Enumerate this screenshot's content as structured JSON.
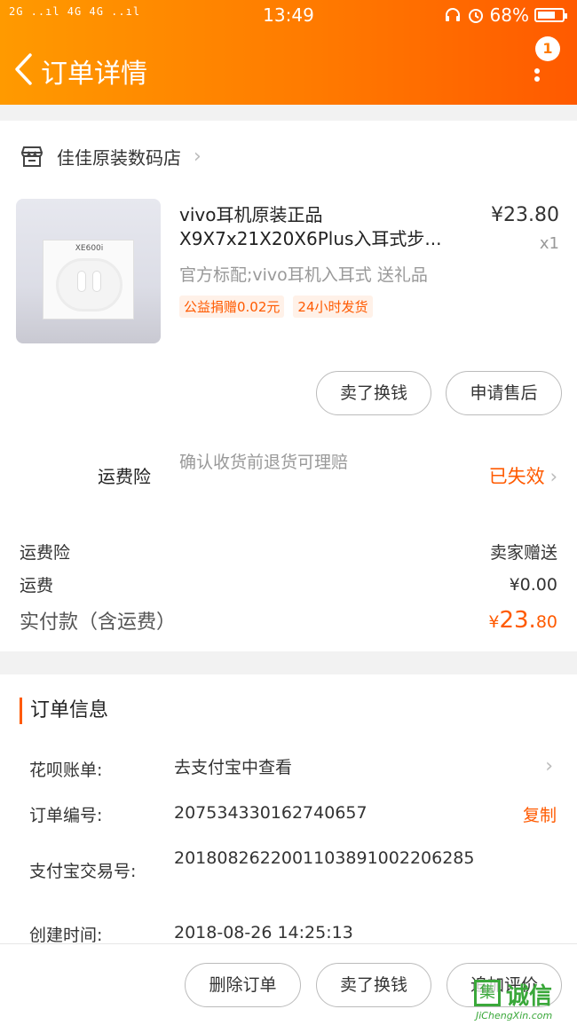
{
  "status_bar": {
    "signal": "2G ..ıl 4G 4G ..ıl",
    "time": "13:49",
    "icons": [
      "headset-icon",
      "alarm-icon"
    ],
    "battery": "68%"
  },
  "nav": {
    "back_icon": "‹",
    "title": "订单详情",
    "more_badge": "1"
  },
  "shop": {
    "name": "佳佳原装数码店",
    "chevron": "›"
  },
  "product": {
    "image_label": "XE600i",
    "title_line1": "vivo耳机原装正品",
    "title_line2": "X9X7x21X20X6Plus入耳式步...",
    "price": "¥23.80",
    "qty": "x1",
    "spec": "官方标配;vivo耳机入耳式 送礼品",
    "tags": [
      "公益捐赠0.02元",
      "24小时发货"
    ]
  },
  "item_actions": {
    "sell": "卖了换钱",
    "after_sale": "申请售后"
  },
  "insurance": {
    "title": "运费险",
    "desc": "确认收货前退货可理赔",
    "status": "已失效",
    "chevron": "›"
  },
  "summary": {
    "rows": [
      {
        "label": "运费险",
        "value": "卖家赠送"
      },
      {
        "label": "运费",
        "value": "¥0.00"
      }
    ],
    "total_label": "实付款（含运费）",
    "total_currency": "¥",
    "total_int": "23.",
    "total_dec": "80"
  },
  "order_info": {
    "title": "订单信息",
    "rows": [
      {
        "label": "花呗账单:",
        "value": "去支付宝中查看",
        "action": "›"
      },
      {
        "label": "订单编号:",
        "value": "207534330162740657",
        "action": "复制"
      },
      {
        "label": "支付宝交易号:",
        "value": "2018082622001103891002206285"
      },
      {
        "label": "创建时间:",
        "value": "2018-08-26 14:25:13"
      }
    ]
  },
  "footer": {
    "delete": "删除订单",
    "sell": "卖了换钱",
    "review": "追加评价"
  },
  "watermark": {
    "logo": "集",
    "text": "诚信",
    "url": "JiChengXin.com"
  },
  "colors": {
    "accent": "#ff5a00",
    "header_start": "#ff9a00",
    "header_end": "#ff5a00"
  }
}
